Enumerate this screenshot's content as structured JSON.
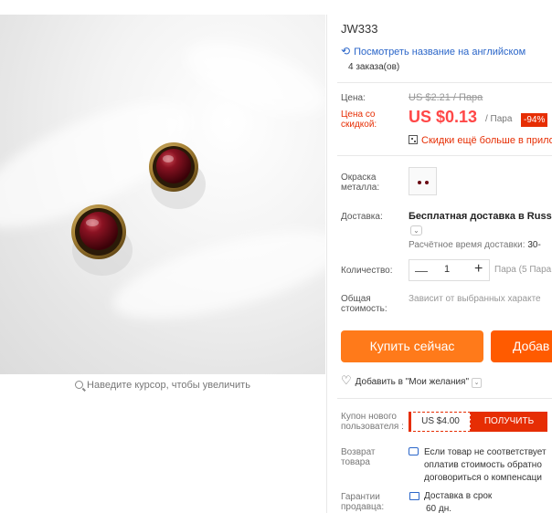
{
  "gallery": {
    "zoom_hint": "Наведите курсор, чтобы увеличить"
  },
  "product": {
    "sku": "JW333",
    "translate_link": "Посмотреть название на английском",
    "orders": "4 заказа(ов)"
  },
  "price": {
    "label": "Цена:",
    "old": "US $2.21 / Пара",
    "discount_label": "Цена со скидкой:",
    "new": "US $0.13",
    "per": "/ Пара",
    "discount_badge": "-94%",
    "app_promo": "Скидки ещё больше в прило"
  },
  "options": {
    "color_label": "Окраска металла:",
    "shipping_label": "Доставка:",
    "shipping_value": "Бесплатная доставка в Russia",
    "delivery_estimate_label": "Расчётное время доставки:",
    "delivery_estimate_value": "30-",
    "quantity_label": "Количество:",
    "quantity_value": "1",
    "quantity_unit": "Пара (5 Пара",
    "total_label": "Общая стоимость:",
    "total_value": "Зависит от выбранных характе"
  },
  "actions": {
    "buy_now": "Купить сейчас",
    "add_to_cart": "Добав",
    "wishlist": "Добавить в \"Мои желания\""
  },
  "coupon": {
    "label": "Купон нового пользователя :",
    "value": "US $4.00",
    "button": "ПОЛУЧИТЬ"
  },
  "returns": {
    "label": "Возврат товара",
    "line1": "Если товар не соответствует",
    "line2": "оплатив стоимость обратно",
    "line3": "договориться о компенсаци"
  },
  "guarantee": {
    "label": "Гарантии продавца:",
    "line1": "Доставка в срок",
    "line2": "60 дн."
  },
  "colors": {
    "price_red": "#ff4747",
    "buy_orange": "#ff7a1a",
    "cart_orange": "#ff5b00",
    "link_blue": "#2b66c9",
    "garnet": "#6a0a14"
  }
}
